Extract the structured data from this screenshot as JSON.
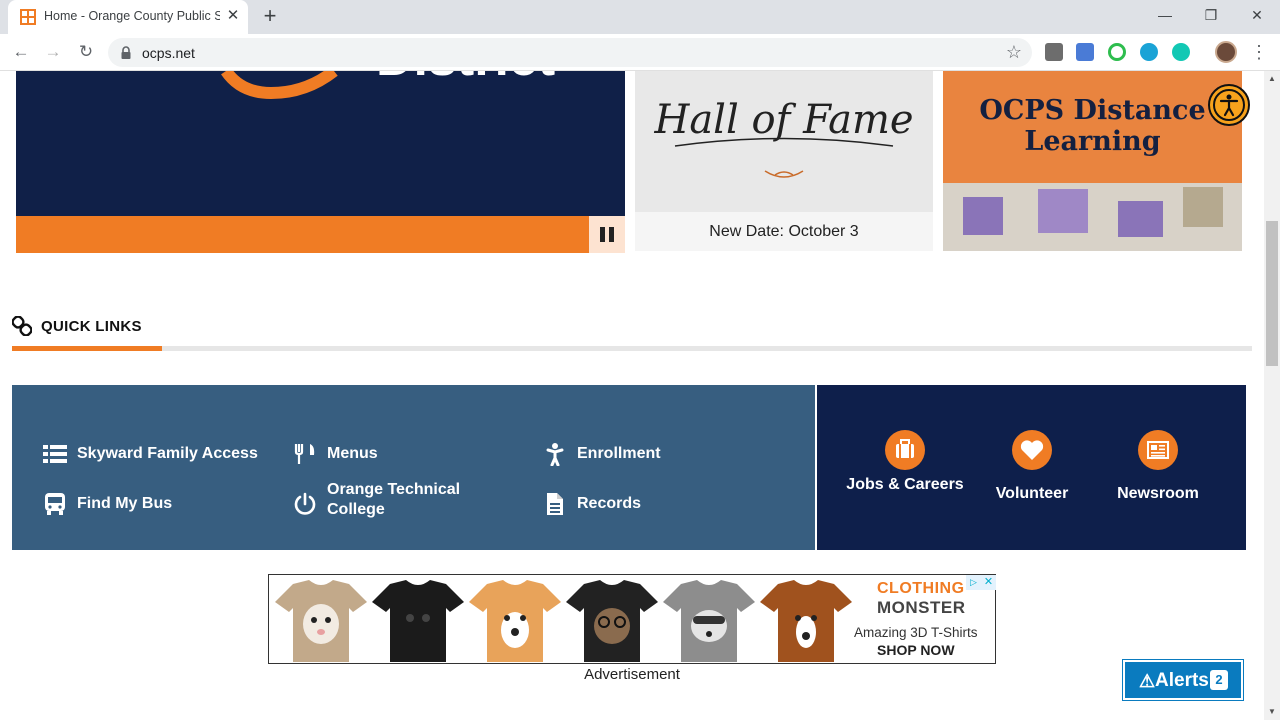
{
  "browser": {
    "tab_title": "Home - Orange County Public Schools",
    "new_tab": "+",
    "tab_close": "✕",
    "url": "ocps.net",
    "window_controls": {
      "minimize": "—",
      "restore": "❐",
      "close": "✕"
    },
    "nav": {
      "back": "←",
      "forward": "→",
      "reload": "↻"
    },
    "star": "☆",
    "menu": "⋮"
  },
  "hero": {
    "hero_partial_text": "District",
    "pause_icon": "pause-icon"
  },
  "cards": {
    "hall_of_fame": {
      "image_text": "Hall of Fame",
      "caption": "New Date: October 3"
    },
    "distance_learning": {
      "title": "OCPS Distance Learning"
    }
  },
  "quick_links": {
    "title": "QUICK LINKS",
    "items": [
      {
        "label": "Skyward Family Access",
        "icon": "list-icon"
      },
      {
        "label": "Menus",
        "icon": "utensils-icon"
      },
      {
        "label": "Enrollment",
        "icon": "child-icon"
      },
      {
        "label": "Find My Bus",
        "icon": "bus-icon"
      },
      {
        "label": "Orange Technical College",
        "icon": "power-icon"
      },
      {
        "label": "Records",
        "icon": "document-icon"
      }
    ],
    "featured": [
      {
        "label": "Jobs & Careers",
        "icon": "briefcase-icon"
      },
      {
        "label": "Volunteer",
        "icon": "heart-icon"
      },
      {
        "label": "Newsroom",
        "icon": "newspaper-icon"
      }
    ]
  },
  "ad": {
    "brand_line1": "CLOTHING",
    "brand_line2": "MONSTER",
    "tagline": "Amazing 3D T-Shirts",
    "cta": "SHOP NOW",
    "choices": "▷",
    "close": "✕",
    "caption": "Advertisement"
  },
  "alerts": {
    "label": "Alerts",
    "icon": "⚠",
    "count": "2"
  },
  "colors": {
    "orange": "#f07c24",
    "navy": "#0e1f4b",
    "slate": "#375e80",
    "alert_blue": "#0a7bbf"
  }
}
